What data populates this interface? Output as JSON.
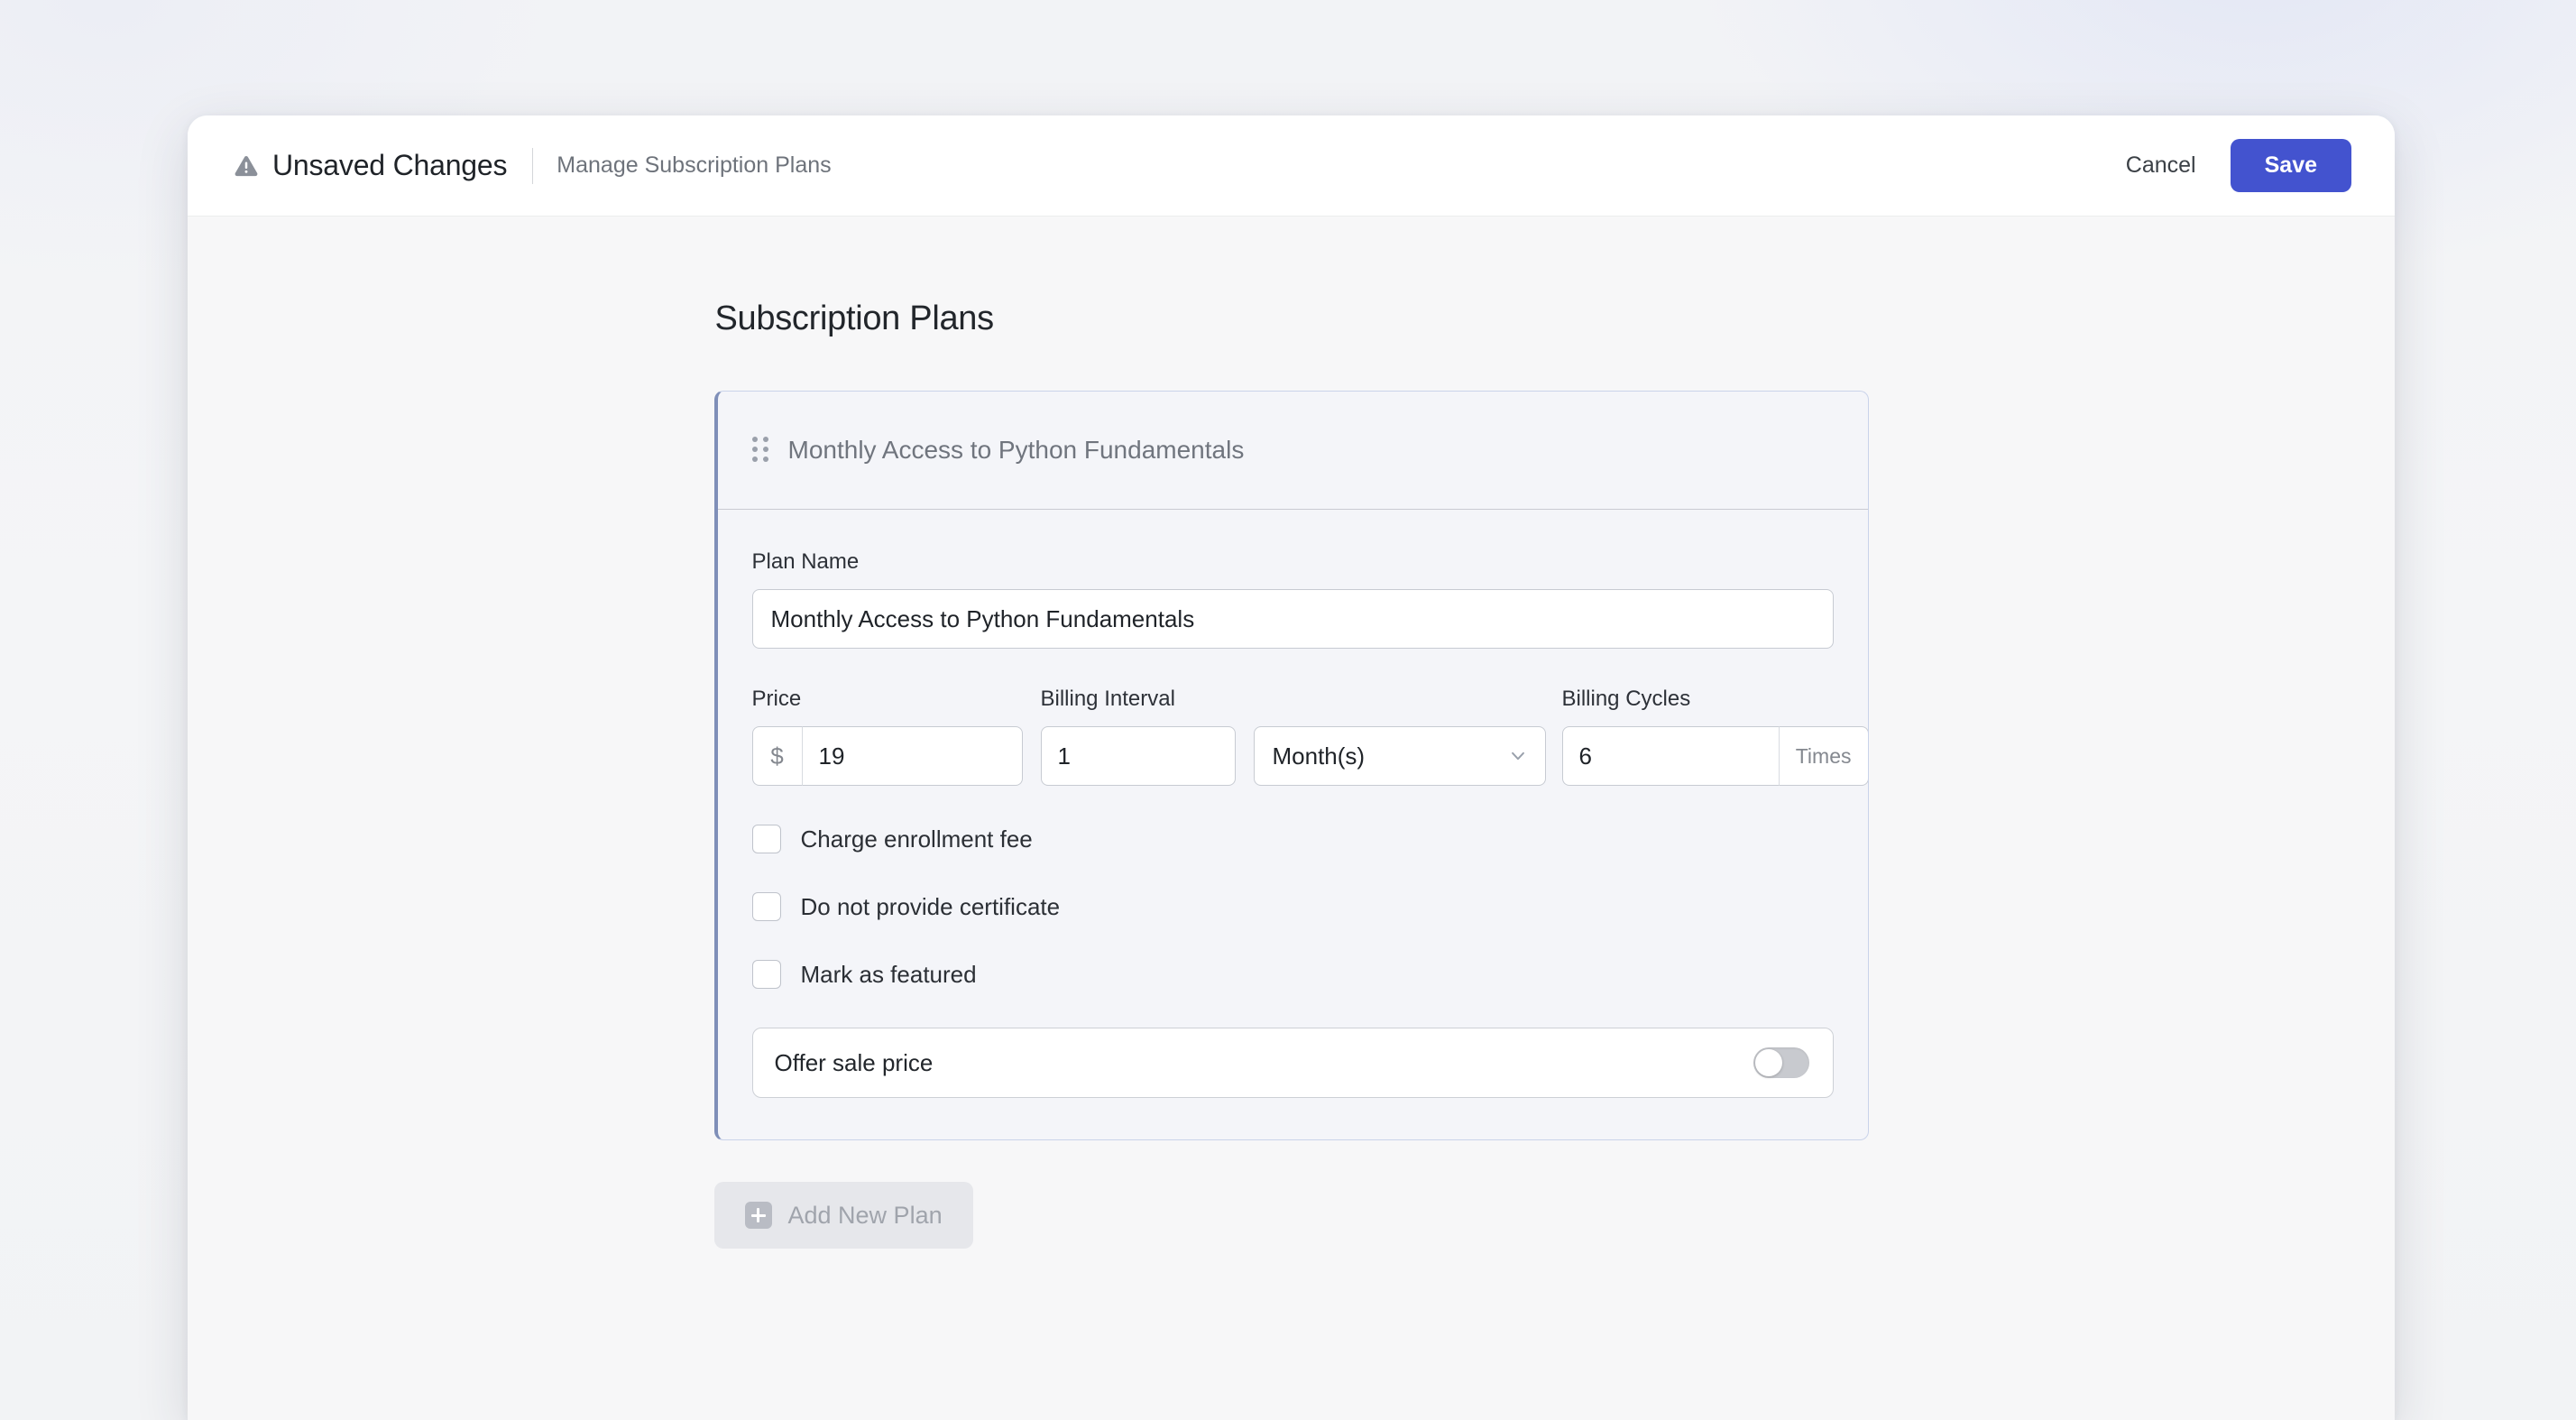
{
  "topbar": {
    "warning_icon": "warning-triangle-icon",
    "unsaved_title": "Unsaved Changes",
    "breadcrumb_sub": "Manage Subscription Plans",
    "cancel_label": "Cancel",
    "save_label": "Save",
    "save_color": "#4353cf"
  },
  "page": {
    "title": "Subscription Plans"
  },
  "plan_card": {
    "header_title": "Monthly Access to Python Fundamentals",
    "drag_handle_icon": "drag-handle-icon",
    "accent_color": "#7f8fb8",
    "fields": {
      "plan_name_label": "Plan Name",
      "plan_name_value": "Monthly Access to Python Fundamentals",
      "price_label": "Price",
      "price_prefix": "$",
      "price_value": "19",
      "billing_interval_label": "Billing Interval",
      "billing_interval_value": "1",
      "billing_unit_value": "Month(s)",
      "billing_unit_icon": "chevron-down-icon",
      "billing_cycles_label": "Billing Cycles",
      "billing_cycles_value": "6",
      "billing_cycles_suffix": "Times"
    },
    "checkboxes": [
      {
        "label": "Charge enrollment fee",
        "checked": false
      },
      {
        "label": "Do not provide certificate",
        "checked": false
      },
      {
        "label": "Mark as featured",
        "checked": false
      }
    ],
    "toggle": {
      "label": "Offer sale price",
      "state": "off"
    }
  },
  "add_plan": {
    "icon": "plus-icon",
    "label": "Add New Plan"
  }
}
